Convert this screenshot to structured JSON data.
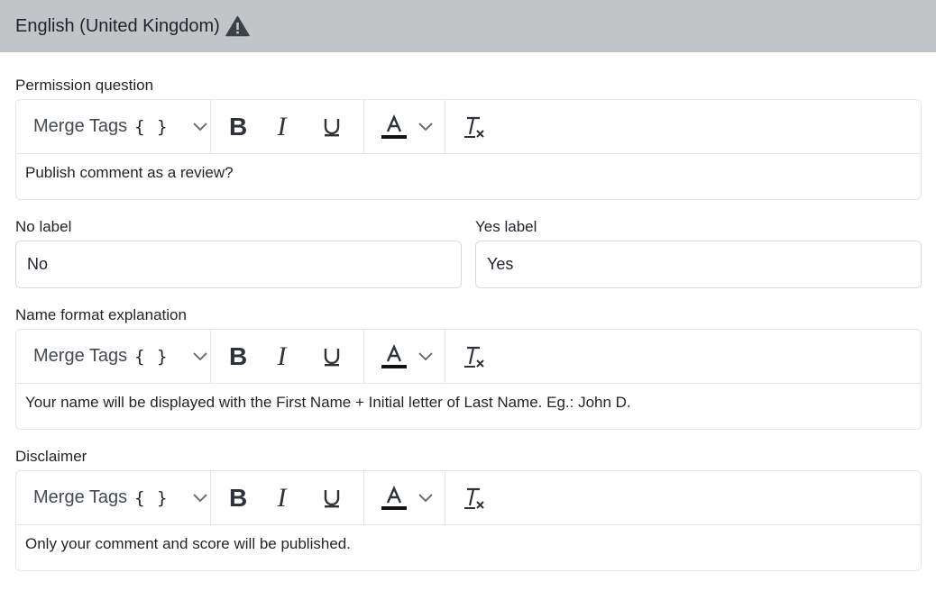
{
  "header": {
    "language": "English (United Kingdom)",
    "warning_icon": "warning-triangle-icon"
  },
  "toolbar": {
    "merge_tags_label": "Merge Tags",
    "merge_tags_braces": "{ }",
    "bold_label": "B",
    "italic_label": "I",
    "underline_label": "U",
    "text_color_label": "A",
    "icons": [
      "chevron-down-icon",
      "text-color-icon",
      "clear-format-icon"
    ]
  },
  "permission_question": {
    "label": "Permission question",
    "value": "Publish comment as a review?"
  },
  "no_label": {
    "label": "No label",
    "value": "No"
  },
  "yes_label": {
    "label": "Yes label",
    "value": "Yes"
  },
  "name_format": {
    "label": "Name format explanation",
    "value": "Your name will be displayed with the First Name + Initial letter of Last Name. Eg.: John D."
  },
  "disclaimer": {
    "label": "Disclaimer",
    "value": "Only your comment and score will be published."
  },
  "colors": {
    "header_bg": "#c2c5c8",
    "border": "#e3e5e8",
    "text": "#1f2328"
  }
}
